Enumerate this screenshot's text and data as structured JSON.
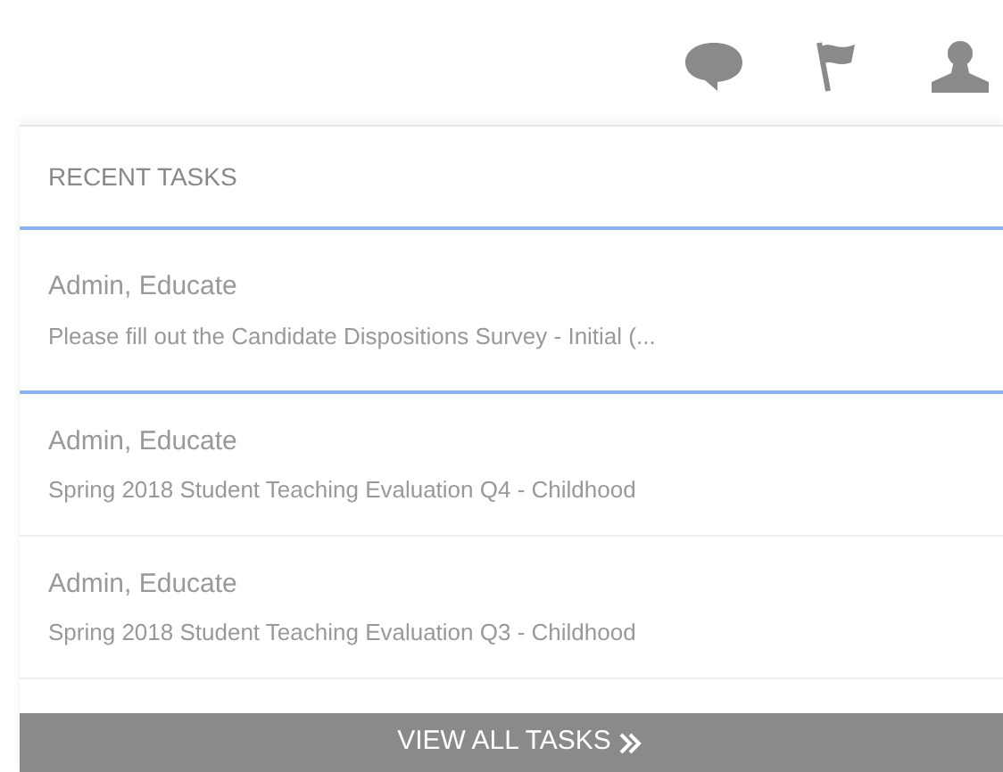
{
  "header_icons": [
    {
      "kind": "chat"
    },
    {
      "kind": "flag"
    },
    {
      "kind": "user"
    }
  ],
  "panel": {
    "title": "RECENT TASKS",
    "tasks": [
      {
        "author": "Admin, Educate",
        "description": "Please fill out the Candidate Dispositions Survey - Initial (...",
        "selected": true
      },
      {
        "author": "Admin, Educate",
        "description": "Spring 2018 Student Teaching Evaluation Q4 - Childhood",
        "selected": false
      },
      {
        "author": "Admin, Educate",
        "description": "Spring 2018 Student Teaching Evaluation Q3 - Childhood",
        "selected": false
      }
    ],
    "footer_button": "VIEW ALL TASKS"
  }
}
